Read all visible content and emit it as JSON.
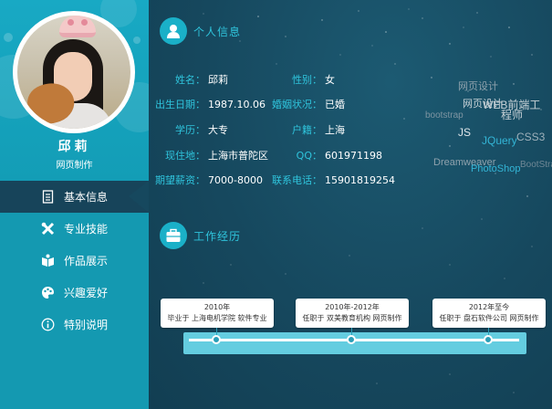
{
  "sidebar": {
    "name": "邱莉",
    "role": "网页制作",
    "nav": [
      {
        "label": "基本信息",
        "icon": "document-icon",
        "active": true
      },
      {
        "label": "专业技能",
        "icon": "tools-icon",
        "active": false
      },
      {
        "label": "作品展示",
        "icon": "book-icon",
        "active": false
      },
      {
        "label": "兴趣爱好",
        "icon": "palette-icon",
        "active": false
      },
      {
        "label": "特别说明",
        "icon": "info-icon",
        "active": false
      }
    ]
  },
  "personal": {
    "title": "个人信息",
    "left": [
      {
        "label": "姓名：",
        "value": "邱莉"
      },
      {
        "label": "出生日期：",
        "value": "1987.10.06"
      },
      {
        "label": "学历：",
        "value": "大专"
      },
      {
        "label": "现住地：",
        "value": "上海市普陀区"
      },
      {
        "label": "期望薪资：",
        "value": "7000-8000"
      }
    ],
    "right": [
      {
        "label": "性别：",
        "value": "女"
      },
      {
        "label": "婚姻状况：",
        "value": "已婚"
      },
      {
        "label": "户籍：",
        "value": "上海"
      },
      {
        "label": "QQ：",
        "value": "601971198"
      },
      {
        "label": "联系电话：",
        "value": "15901819254"
      }
    ]
  },
  "skills_cloud": [
    {
      "text": "网页设计",
      "color": "#8fa2ad"
    },
    {
      "text": "网页设计",
      "color": "#c9d3d8"
    },
    {
      "text": "WEB前端工",
      "color": "#c9d3d8"
    },
    {
      "text": "程师",
      "color": "#c9d3d8"
    },
    {
      "text": "bootstrap",
      "color": "#7e95a2"
    },
    {
      "text": "JS",
      "color": "#dfe6ea"
    },
    {
      "text": "JQuery",
      "color": "#33b5d6"
    },
    {
      "text": "CSS3",
      "color": "#9fb1bb"
    },
    {
      "text": "Dreamweaver",
      "color": "#8fa2ad"
    },
    {
      "text": "BootStrap",
      "color": "#6f8795"
    },
    {
      "text": "PhotoShop",
      "color": "#33b5d6"
    }
  ],
  "work": {
    "title": "工作经历",
    "events": [
      {
        "date": "2010年",
        "desc": "毕业于 上海电机学院 软件专业"
      },
      {
        "date": "2010年-2012年",
        "desc": "任职于 双美教育机构 网页制作"
      },
      {
        "date": "2012年至今",
        "desc": "任职于 盘石软件公司 网页制作"
      }
    ]
  },
  "colors": {
    "sidebar": "#1499b1",
    "main_bg": "#16485e",
    "accent": "#2fc4dc"
  }
}
